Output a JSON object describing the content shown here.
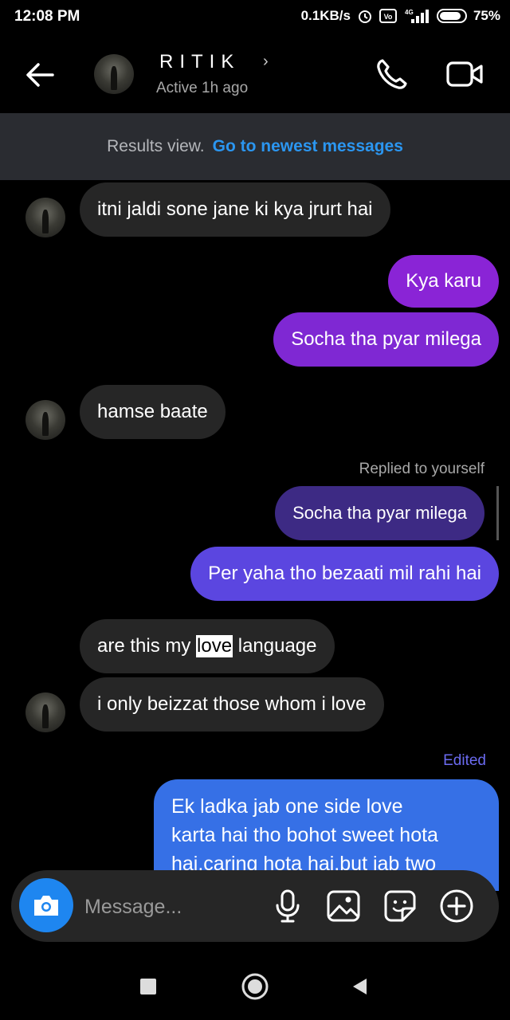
{
  "status_bar": {
    "time": "12:08 PM",
    "speed": "0.1KB/s",
    "volte": "Vo LTE",
    "network": "4G",
    "battery": "75%"
  },
  "header": {
    "name": "RITIK",
    "chevron": "›",
    "status": "Active 1h ago",
    "icons": [
      "back-arrow-icon",
      "phone-icon",
      "video-camera-icon"
    ]
  },
  "banner": {
    "label": "Results view.",
    "link": "Go to newest messages"
  },
  "messages": [
    {
      "side": "in",
      "text": "itni jaldi sone jane ki kya jrurt hai"
    },
    {
      "side": "out",
      "text": "Kya karu"
    },
    {
      "side": "out",
      "text": "Socha tha pyar milega"
    },
    {
      "side": "in",
      "text": "hamse baate"
    },
    {
      "side": "meta",
      "text": "Replied to yourself"
    },
    {
      "side": "out-quoted",
      "text": "Socha tha pyar milega"
    },
    {
      "side": "out",
      "text": "Per yaha tho bezaati mil rahi hai"
    },
    {
      "side": "in",
      "text_before": "are this my ",
      "text_highlight": "love",
      "text_after": " language"
    },
    {
      "side": "in",
      "text": "i only beizzat those whom i love"
    },
    {
      "side": "meta",
      "text": "Edited"
    },
    {
      "side": "out",
      "lines": [
        "Ek ladka jab one side love",
        "karta hai tho bohot sweet hota",
        "hai.caring hota hai.but jab two"
      ]
    }
  ],
  "composer": {
    "placeholder": "Message...",
    "icons": [
      "camera-icon",
      "microphone-icon",
      "gallery-icon",
      "sticker-icon",
      "add-circle-icon"
    ]
  },
  "colors": {
    "background": "#000000",
    "incoming_bubble": "#262626",
    "outgoing_purple": "#8a24d6",
    "outgoing_blue": "#3670e6",
    "link_blue": "#2b96f0",
    "edited": "#6b6bf0"
  }
}
